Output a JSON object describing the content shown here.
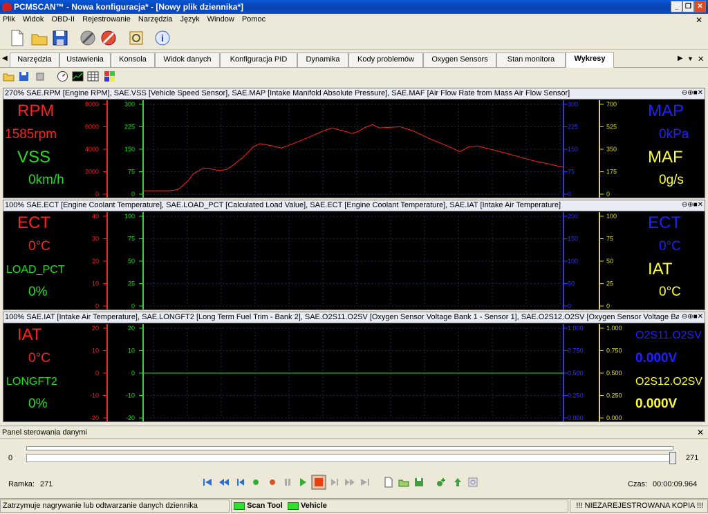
{
  "window": {
    "title": "PCMSCAN™ - Nowa konfiguracja* - [Nowy plik dziennika*]",
    "min": "_",
    "restore": "❐",
    "close": "✕"
  },
  "menu": [
    "Plik",
    "Widok",
    "OBD-II",
    "Rejestrowanie",
    "Narzędzia",
    "Język",
    "Window",
    "Pomoc"
  ],
  "menu_close": "✕",
  "tabs": [
    "Narzędzia",
    "Ustawienia",
    "Konsola",
    "Widok danych",
    "Konfiguracja PID",
    "Dynamika",
    "Kody problemów",
    "Oxygen Sensors",
    "Stan monitora",
    "Wykresy"
  ],
  "active_tab": "Wykresy",
  "tab_nav": {
    "left": "◀",
    "right": "▶",
    "menu": "▼",
    "close": "✕"
  },
  "panel_controls": "⊖⊕■✕",
  "panels": [
    {
      "header": "270% SAE.RPM [Engine RPM], SAE.VSS [Vehicle Speed Sensor], SAE.MAP [Intake Manifold Absolute Pressure], SAE.MAF [Air Flow Rate from Mass Air Flow Sensor]",
      "left": [
        {
          "label": "RPM",
          "value": "1585rpm",
          "color": "#ff2020"
        },
        {
          "label": "VSS",
          "value": "0km/h",
          "color": "#20e020"
        }
      ],
      "right": [
        {
          "label": "MAP",
          "value": "0kPa",
          "color": "#2020ff"
        },
        {
          "label": "MAF",
          "value": "0g/s",
          "color": "#ffff30"
        }
      ],
      "axes": [
        {
          "ticks": [
            "8000",
            "6000",
            "4000",
            "2000",
            "0"
          ],
          "color": "#ff2020"
        },
        {
          "ticks": [
            "300",
            "225",
            "150",
            "75",
            "0"
          ],
          "color": "#20e020"
        },
        {
          "ticks": [
            "300",
            "225",
            "150",
            "75",
            "0"
          ],
          "color": "#3030ff"
        },
        {
          "ticks": [
            "700",
            "525",
            "350",
            "175",
            "0"
          ],
          "color": "#e0e020"
        }
      ]
    },
    {
      "header": "100% SAE.ECT [Engine Coolant Temperature], SAE.LOAD_PCT [Calculated Load Value], SAE.ECT [Engine Coolant Temperature], SAE.IAT [Intake Air Temperature]",
      "left": [
        {
          "label": "ECT",
          "value": "0°C",
          "color": "#ff2020"
        },
        {
          "label": "LOAD_PCT",
          "value": "0%",
          "color": "#20e020"
        }
      ],
      "right": [
        {
          "label": "ECT",
          "value": "0°C",
          "color": "#2020ff"
        },
        {
          "label": "IAT",
          "value": "0°C",
          "color": "#ffff30"
        }
      ],
      "axes": [
        {
          "ticks": [
            "40",
            "30",
            "20",
            "10",
            "0"
          ],
          "color": "#ff2020"
        },
        {
          "ticks": [
            "100",
            "75",
            "50",
            "25",
            "0"
          ],
          "color": "#20e020"
        },
        {
          "ticks": [
            "200",
            "150",
            "100",
            "50",
            "0"
          ],
          "color": "#3030ff"
        },
        {
          "ticks": [
            "100",
            "75",
            "50",
            "25",
            "0"
          ],
          "color": "#e0e020"
        }
      ]
    },
    {
      "header": "100% SAE.IAT [Intake Air Temperature], SAE.LONGFT2 [Long Term Fuel Trim - Bank 2], SAE.O2S11.O2SV [Oxygen Sensor Voltage Bank 1 - Sensor 1], SAE.O2S12.O2SV [Oxygen Sensor Voltage Ba...",
      "left": [
        {
          "label": "IAT",
          "value": "0°C",
          "color": "#ff2020"
        },
        {
          "label": "LONGFT2",
          "value": "0%",
          "color": "#20e020"
        }
      ],
      "right": [
        {
          "label": "O2S11.O2SV",
          "value": "0.000V",
          "color": "#2020ff"
        },
        {
          "label": "O2S12.O2SV",
          "value": "0.000V",
          "color": "#ffff30"
        }
      ],
      "axes": [
        {
          "ticks": [
            "20",
            "10",
            "0",
            "-10",
            "-20"
          ],
          "color": "#ff2020"
        },
        {
          "ticks": [
            "20",
            "10",
            "0",
            "-10",
            "-20"
          ],
          "color": "#20e020"
        },
        {
          "ticks": [
            "1.000",
            "0.750",
            "0.500",
            "0.250",
            "0.000"
          ],
          "color": "#3030ff"
        },
        {
          "ticks": [
            "1.000",
            "0.750",
            "0.500",
            "0.250",
            "0.000"
          ],
          "color": "#e0e020"
        }
      ]
    }
  ],
  "chart_data": {
    "type": "line",
    "series": [
      {
        "name": "RPM",
        "x": [
          0,
          12,
          20,
          38,
          50,
          65,
          72,
          86,
          96,
          100,
          110,
          120,
          130,
          144,
          152,
          158,
          168,
          186,
          199,
          220,
          240,
          258,
          272,
          296,
          300,
          310,
          318,
          330,
          340,
          370,
          390,
          410,
          430,
          445,
          455,
          460,
          468,
          480,
          500,
          525,
          560,
          605
        ],
        "values": [
          300,
          300,
          300,
          300,
          400,
          1200,
          1800,
          2300,
          2300,
          2200,
          2100,
          2200,
          2600,
          3300,
          3800,
          4200,
          4500,
          4300,
          4100,
          4600,
          5100,
          5600,
          5900,
          5500,
          5400,
          5600,
          5900,
          6200,
          5900,
          6000,
          5600,
          5000,
          4500,
          4100,
          3800,
          3900,
          4200,
          4300,
          4000,
          3600,
          3000,
          2400
        ]
      }
    ]
  },
  "control_panel": {
    "title": "Panel sterowania danymi",
    "close": "✕",
    "slider_min": "0",
    "slider_max": "271",
    "slider_position": 1.0,
    "frame_label": "Ramka:",
    "frame_value": "271",
    "time_label": "Czas:",
    "time_value": "00:00:09.964"
  },
  "status": {
    "message": "Zatrzymuje nagrywanie lub odtwarzanie danych dziennika",
    "scan_tool": "Scan Tool",
    "vehicle": "Vehicle",
    "unregistered": "!!! NIEZAREJESTROWANA KOPIA !!!"
  },
  "colors": {
    "led": "#30e030",
    "accent": "#0a4ec8"
  }
}
